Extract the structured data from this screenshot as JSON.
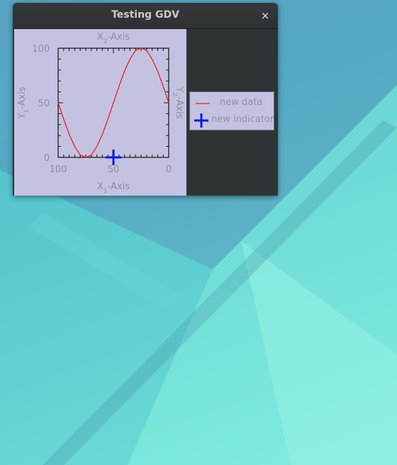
{
  "window": {
    "title": "Testing GDV",
    "close_label": "×"
  },
  "plot": {
    "x2_axis_label": "X2-Axis",
    "y2_axis_label": "Y2-Axis",
    "x1_axis_label": "X1-Axis",
    "y1_axis_label": "Y1-Axis"
  },
  "chart_data": {
    "type": "line",
    "title": "",
    "xlabel": "X1-Axis",
    "ylabel": "Y1-Axis",
    "x2label": "X2-Axis",
    "y2label": "Y2-Axis",
    "xlim": [
      100,
      0
    ],
    "ylim": [
      0,
      100
    ],
    "x_ticks": [
      "100",
      "50",
      "0"
    ],
    "y_ticks": [
      "0",
      "50",
      "100"
    ],
    "x_reversed": true,
    "grid": false,
    "legend_position": "right",
    "series": [
      {
        "name": "new data",
        "color": "#e8202a",
        "x": [
          0,
          5,
          10,
          15,
          20,
          25,
          30,
          35,
          40,
          45,
          50,
          55,
          60,
          65,
          70,
          75,
          80,
          85,
          90,
          95,
          100
        ],
        "y": [
          50,
          65,
          79,
          90,
          98,
          100,
          98,
          90,
          79,
          65,
          50,
          35,
          21,
          10,
          2,
          0,
          2,
          10,
          21,
          35,
          50
        ]
      }
    ],
    "indicators": [
      {
        "name": "new indicator",
        "color": "#1515e0",
        "x": 50,
        "y": 0
      }
    ]
  },
  "legend": {
    "items": [
      {
        "label": "new data",
        "color": "#e8202a"
      },
      {
        "label": "new indicator",
        "color": "#1515e0"
      }
    ]
  }
}
